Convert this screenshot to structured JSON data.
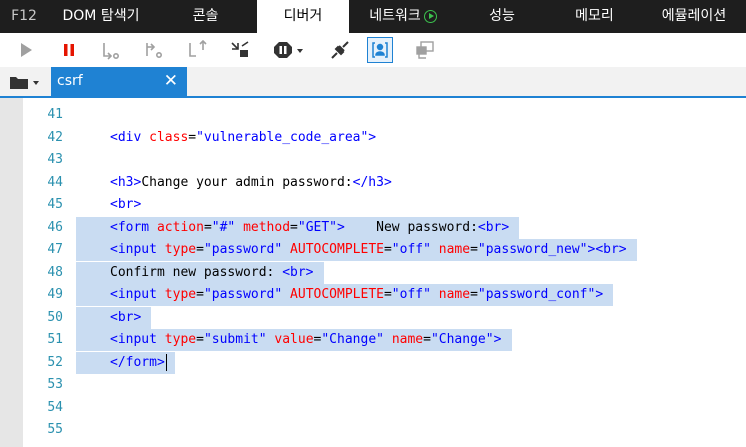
{
  "tabs": {
    "f12": "F12",
    "dom": "DOM 탐색기",
    "console": "콘솔",
    "debugger": "디버거",
    "network": "네트워크",
    "performance": "성능",
    "memory": "메모리",
    "emulation": "에뮬레이션"
  },
  "toolbar": {
    "icons": [
      "play-icon",
      "pause-icon",
      "step-into-icon",
      "step-over-icon",
      "step-out-icon",
      "break-on-new-worker-icon",
      "exception-behavior-icon",
      "disconnect-debugger-icon",
      "just-my-code-icon",
      "frame-icon"
    ],
    "active": "just-my-code-icon"
  },
  "file_tab": {
    "name": "csrf",
    "close": "✕"
  },
  "colors": {
    "accent": "#1f82d3",
    "selection": "#c9dcf2",
    "tag": "#0000ff",
    "attr": "#ff0000",
    "line_number": "#2b91af"
  },
  "editor": {
    "lines": [
      {
        "n": "41",
        "code": ""
      },
      {
        "n": "42",
        "code": "<div class=\"vulnerable_code_area\">"
      },
      {
        "n": "43",
        "code": ""
      },
      {
        "n": "44",
        "code": "<h3>Change your admin password:</h3>"
      },
      {
        "n": "45",
        "code": "<br>"
      },
      {
        "n": "46",
        "code": "<form action=\"#\" method=\"GET\">    New password:<br>"
      },
      {
        "n": "47",
        "code": "<input type=\"password\" AUTOCOMPLETE=\"off\" name=\"password_new\"><br>"
      },
      {
        "n": "48",
        "code": "Confirm new password: <br>"
      },
      {
        "n": "49",
        "code": "<input type=\"password\" AUTOCOMPLETE=\"off\" name=\"password_conf\">"
      },
      {
        "n": "50",
        "code": "<br>"
      },
      {
        "n": "51",
        "code": "<input type=\"submit\" value=\"Change\" name=\"Change\">"
      },
      {
        "n": "52",
        "code": "</form>"
      },
      {
        "n": "53",
        "code": ""
      },
      {
        "n": "54",
        "code": ""
      },
      {
        "n": "55",
        "code": ""
      }
    ],
    "selected_lines": [
      "46",
      "47",
      "48",
      "49",
      "50",
      "51",
      "52"
    ]
  }
}
